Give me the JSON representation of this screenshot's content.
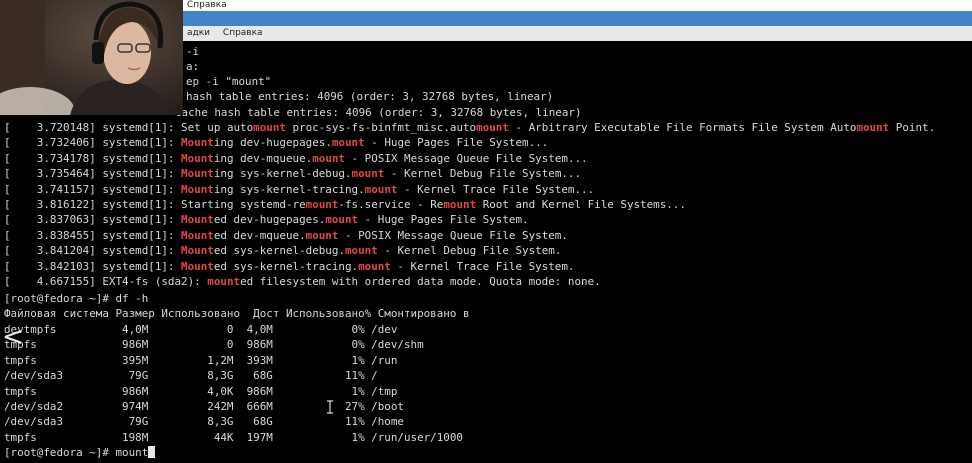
{
  "window": {
    "title": "Справка",
    "menu": [
      "адки",
      "Справка"
    ]
  },
  "terminal": {
    "top_fragments": [
      "-i",
      "a:",
      "ep -i \"mount\"",
      "hash table entries: 4096 (order: 3, 32768 bytes, linear)"
    ],
    "partial_line": "cache hash table entries: 4096 (order: 3, 32768 bytes, linear)",
    "log": [
      {
        "ts": "3.720148",
        "src": "systemd[1]:",
        "parts": [
          [
            "Set up auto",
            0
          ],
          [
            "mount",
            1
          ],
          [
            " proc-sys-fs-binfmt_misc.auto",
            0
          ],
          [
            "mount",
            1
          ],
          [
            " - Arbitrary Executable File Formats File System Auto",
            0
          ],
          [
            "mount",
            1
          ],
          [
            " Point.",
            0
          ]
        ]
      },
      {
        "ts": "3.732406",
        "src": "systemd[1]:",
        "parts": [
          [
            "Mount",
            1
          ],
          [
            "ing dev-hugepages.",
            0
          ],
          [
            "mount",
            1
          ],
          [
            " - Huge Pages File System...",
            0
          ]
        ]
      },
      {
        "ts": "3.734178",
        "src": "systemd[1]:",
        "parts": [
          [
            "Mount",
            1
          ],
          [
            "ing dev-mqueue.",
            0
          ],
          [
            "mount",
            1
          ],
          [
            " - POSIX Message Queue File System...",
            0
          ]
        ]
      },
      {
        "ts": "3.735464",
        "src": "systemd[1]:",
        "parts": [
          [
            "Mount",
            1
          ],
          [
            "ing sys-kernel-debug.",
            0
          ],
          [
            "mount",
            1
          ],
          [
            " - Kernel Debug File System...",
            0
          ]
        ]
      },
      {
        "ts": "3.741157",
        "src": "systemd[1]:",
        "parts": [
          [
            "Mount",
            1
          ],
          [
            "ing sys-kernel-tracing.",
            0
          ],
          [
            "mount",
            1
          ],
          [
            " - Kernel Trace File System...",
            0
          ]
        ]
      },
      {
        "ts": "3.816122",
        "src": "systemd[1]:",
        "parts": [
          [
            "Starting systemd-re",
            0
          ],
          [
            "mount",
            1
          ],
          [
            "-fs.service - Re",
            0
          ],
          [
            "mount",
            1
          ],
          [
            " Root and Kernel File Systems...",
            0
          ]
        ]
      },
      {
        "ts": "3.837063",
        "src": "systemd[1]:",
        "parts": [
          [
            "Mount",
            1
          ],
          [
            "ed dev-hugepages.",
            0
          ],
          [
            "mount",
            1
          ],
          [
            " - Huge Pages File System.",
            0
          ]
        ]
      },
      {
        "ts": "3.838455",
        "src": "systemd[1]:",
        "parts": [
          [
            "Mount",
            1
          ],
          [
            "ed dev-mqueue.",
            0
          ],
          [
            "mount",
            1
          ],
          [
            " - POSIX Message Queue File System.",
            0
          ]
        ]
      },
      {
        "ts": "3.841204",
        "src": "systemd[1]:",
        "parts": [
          [
            "Mount",
            1
          ],
          [
            "ed sys-kernel-debug.",
            0
          ],
          [
            "mount",
            1
          ],
          [
            " - Kernel Debug File System.",
            0
          ]
        ]
      },
      {
        "ts": "3.842103",
        "src": "systemd[1]:",
        "parts": [
          [
            "Mount",
            1
          ],
          [
            "ed sys-kernel-tracing.",
            0
          ],
          [
            "mount",
            1
          ],
          [
            " - Kernel Trace File System.",
            0
          ]
        ]
      },
      {
        "ts": "4.667155",
        "src": "EXT4-fs (sda2):",
        "parts": [
          [
            "mount",
            1
          ],
          [
            "ed filesystem with ordered data mode. Quota mode: none.",
            0
          ]
        ]
      }
    ],
    "df_prompt": "[root@fedora ~]# df -h",
    "df_header": "Файловая система Размер Использовано  Дост Использовано% Смонтировано в",
    "df_rows": [
      "devtmpfs          4,0M            0  4,0M            0% /dev",
      "tmpfs             986M            0  986M            0% /dev/shm",
      "tmpfs             395M         1,2M  393M            1% /run",
      "/dev/sda3          79G         8,3G   68G           11% /",
      "tmpfs             986M         4,0K  986M            1% /tmp",
      "/dev/sda2         974M         242M  666M           27% /boot",
      "/dev/sda3          79G         8,3G   68G           11% /home",
      "tmpfs             198M          44K  197M            1% /run/user/1000"
    ],
    "current_prompt": "[root@fedora ~]# mount"
  },
  "overlay": {
    "prev_arrow": "<",
    "webcam": "webcam-overlay"
  },
  "colors": {
    "terminal_bg": "#000000",
    "terminal_fg": "#d8d8d8",
    "highlight": "#e0464c",
    "title_accent": "#3f86c8"
  }
}
